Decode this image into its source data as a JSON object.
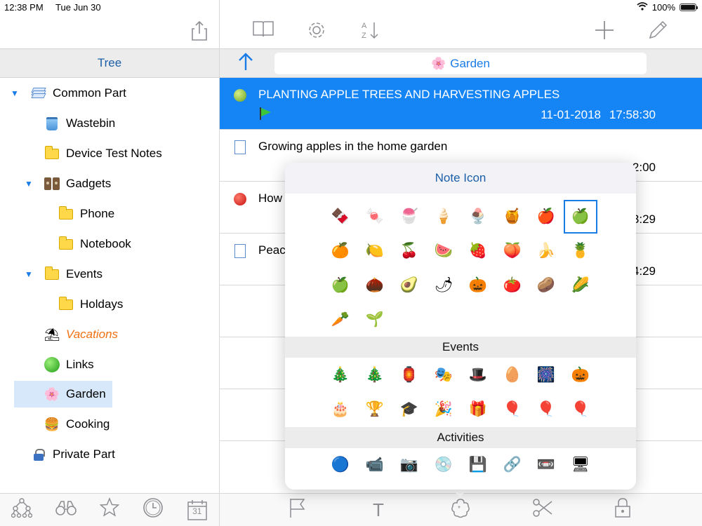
{
  "status": {
    "time": "12:38 PM",
    "date": "Tue Jun 30",
    "battery": "100%",
    "battery_level": 1.0
  },
  "left": {
    "header": "Tree",
    "tree": [
      {
        "label": "Common Part",
        "icon": "layers-icon",
        "expanded": true,
        "level": 0
      },
      {
        "label": "Wastebin",
        "icon": "wastebin-icon",
        "level": 1
      },
      {
        "label": "Device Test Notes",
        "icon": "folder-icon",
        "level": 1
      },
      {
        "label": "Gadgets",
        "icon": "speakers-icon",
        "expanded": true,
        "level": 1
      },
      {
        "label": "Phone",
        "icon": "folder-icon",
        "level": 2
      },
      {
        "label": "Notebook",
        "icon": "folder-icon",
        "level": 2
      },
      {
        "label": "Events",
        "icon": "folder-icon",
        "expanded": true,
        "level": 1
      },
      {
        "label": "Holdays",
        "icon": "folder-icon",
        "level": 2
      },
      {
        "label": "Vacations",
        "icon": "beach-umbrella-icon",
        "level": 1
      },
      {
        "label": "Links",
        "icon": "green-ball-icon",
        "level": 1
      },
      {
        "label": "Garden",
        "icon": "flower-icon",
        "level": 1,
        "selected": true
      },
      {
        "label": "Cooking",
        "icon": "burger-icon",
        "level": 1
      },
      {
        "label": "Private Part",
        "icon": "lock-icon",
        "level": 0
      }
    ],
    "bottom_tabs": [
      "tree-icon",
      "binoculars-icon",
      "star-icon",
      "clock-icon",
      "calendar-icon"
    ],
    "calendar_day": "31"
  },
  "right": {
    "breadcrumb": {
      "icon": "flower-icon",
      "label": "Garden"
    },
    "notes": [
      {
        "title": "PLANTING APPLE TREES AND HARVESTING APPLES",
        "date": "11-01-2018",
        "time": "17:58:30",
        "icon": "green-apple-icon",
        "flag": true,
        "selected": true
      },
      {
        "title": "Growing apples in the home garden",
        "date": "",
        "time": "2:00",
        "icon": "document-icon"
      },
      {
        "title": "How",
        "date": "",
        "time": "3:29",
        "icon": "red-apple-icon"
      },
      {
        "title": "Peac",
        "date": "",
        "time": "4:29",
        "icon": "document-icon"
      }
    ],
    "bottom_icons": [
      "flag-icon",
      "text-icon",
      "flower-badge-icon",
      "scissors-icon",
      "lock-icon"
    ],
    "text_icon_label": "T"
  },
  "popover": {
    "title": "Note Icon",
    "sections": [
      {
        "name": "",
        "icons": [
          [
            "🍫",
            "🍬",
            "🍧",
            "🍦",
            "🍨",
            "🍯",
            "🍎",
            "🍏"
          ],
          [
            "🍊",
            "🍋",
            "🍒",
            "🍉",
            "🍓",
            "🍑",
            "🍌",
            "🍍"
          ],
          [
            "🍏",
            "🌰",
            "🥑",
            "🌶",
            "🎃",
            "🍅",
            "🥔",
            "🌽"
          ],
          [
            "🥕",
            "🌱"
          ]
        ],
        "selected": "0,7"
      },
      {
        "name": "Events",
        "icons": [
          [
            "🎄",
            "🎄",
            "🏮",
            "🎭",
            "🎩",
            "🥚",
            "🎆",
            "🎃"
          ],
          [
            "🎂",
            "🏆",
            "🎓",
            "🎉",
            "🎁",
            "🎈",
            "🎈",
            "🎈"
          ]
        ]
      },
      {
        "name": "Activities",
        "icons": [
          [
            "🔵",
            "📹",
            "📷",
            "💿",
            "💾",
            "🔗",
            "📼",
            "🖥"
          ]
        ]
      }
    ]
  },
  "colors": {
    "accent": "#1a7ce6",
    "selected_row": "#1584f4",
    "tree_selected": "#d6e8fa",
    "header_text": "#1c5fa8",
    "vacations": "#f07010"
  }
}
